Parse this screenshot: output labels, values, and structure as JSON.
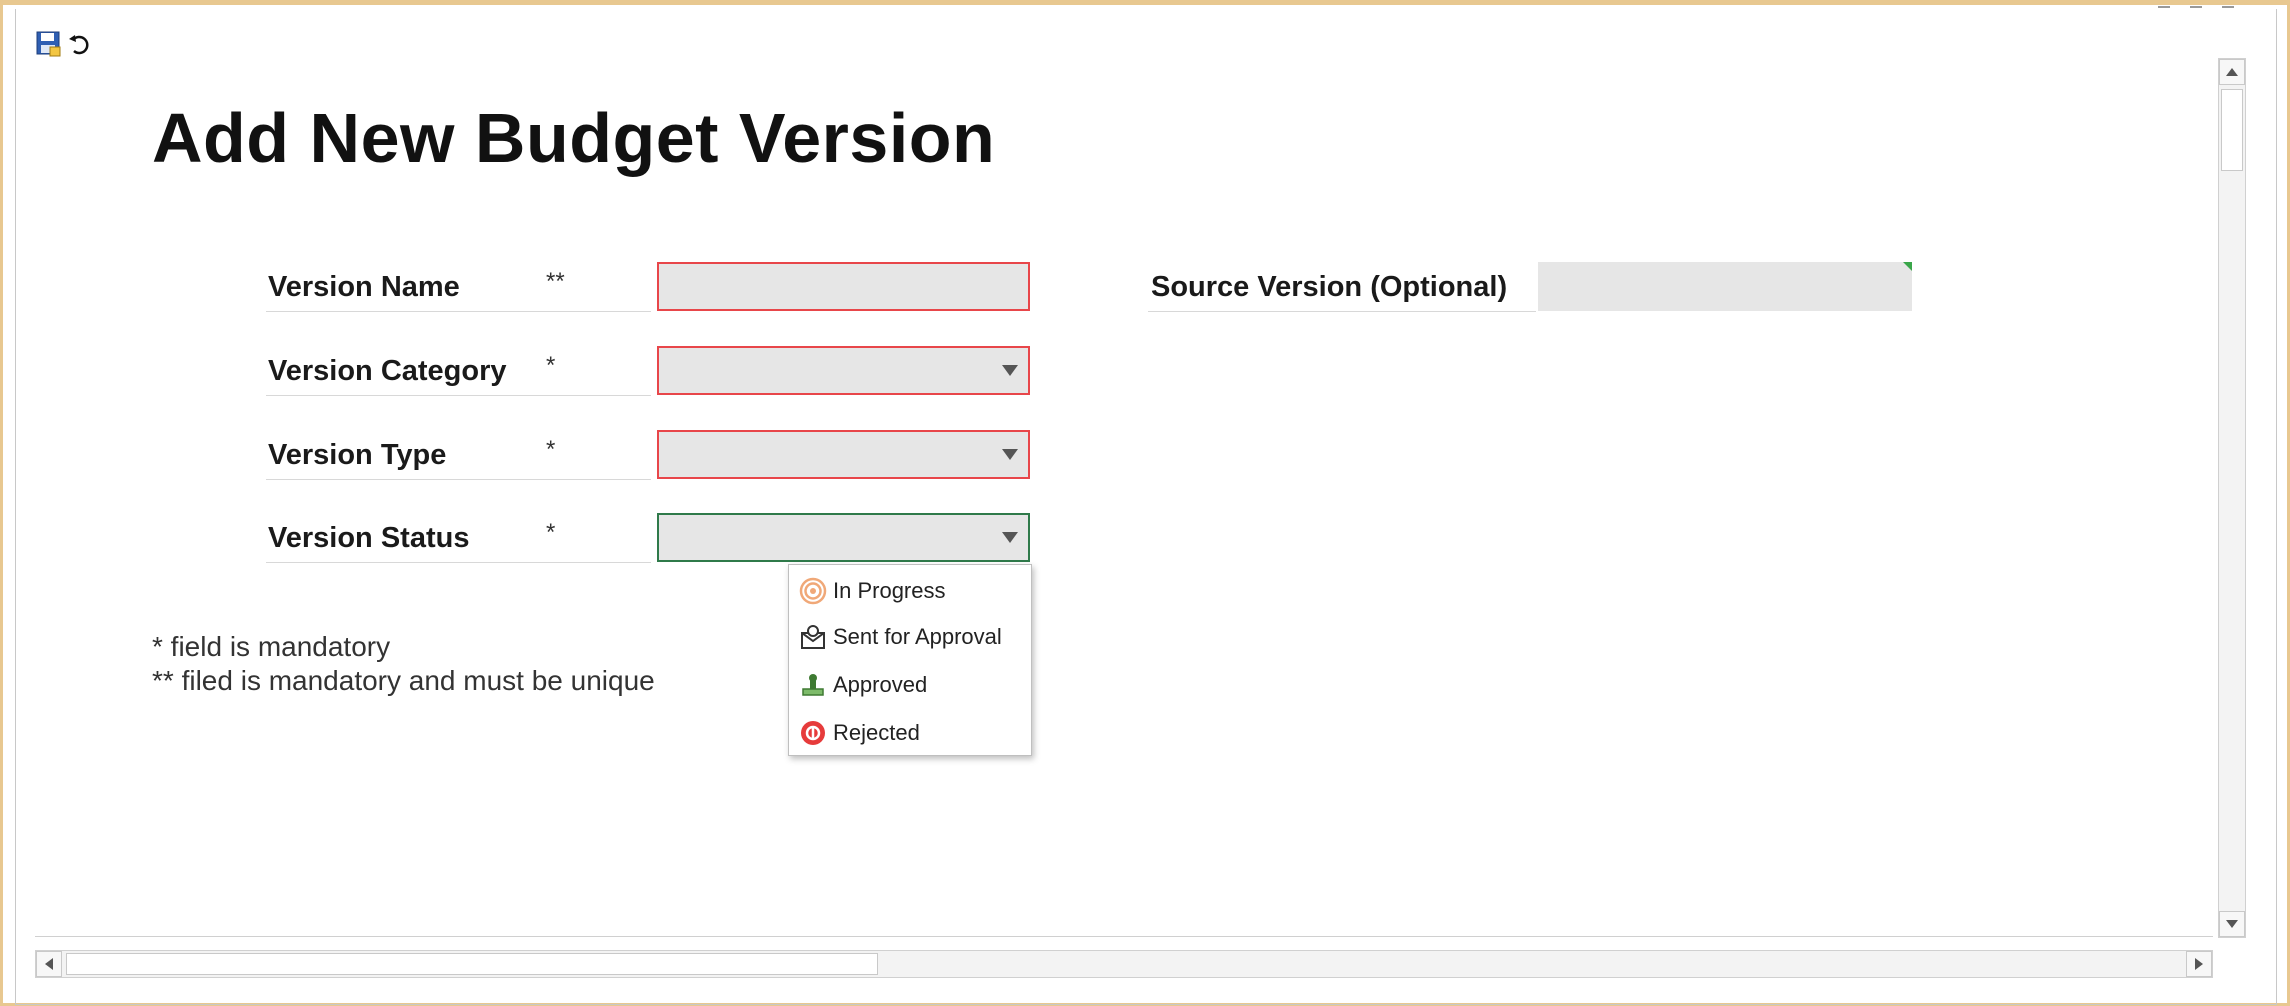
{
  "page": {
    "title": "Add New Budget Version"
  },
  "toolbar": {
    "save_icon": "save-icon",
    "refresh_icon": "refresh-icon"
  },
  "form": {
    "version_name": {
      "label": "Version Name",
      "required": "**",
      "value": ""
    },
    "version_category": {
      "label": "Version Category",
      "required": "*",
      "value": ""
    },
    "version_type": {
      "label": "Version Type",
      "required": "*",
      "value": ""
    },
    "version_status": {
      "label": "Version Status",
      "required": "*",
      "value": ""
    },
    "source_version": {
      "label": "Source Version (Optional)",
      "value": ""
    }
  },
  "notes": {
    "line1": "* field is mandatory",
    "line2": "** filed is mandatory and must be unique"
  },
  "status_dropdown": {
    "options": [
      {
        "label": "In Progress",
        "icon": "in-progress-icon"
      },
      {
        "label": "Sent for Approval",
        "icon": "sent-for-approval-icon"
      },
      {
        "label": "Approved",
        "icon": "approved-icon"
      },
      {
        "label": "Rejected",
        "icon": "rejected-icon"
      }
    ]
  },
  "colors": {
    "required_border": "#e8464a",
    "active_border": "#2f7a4a",
    "field_bg": "#e6e6e6"
  }
}
